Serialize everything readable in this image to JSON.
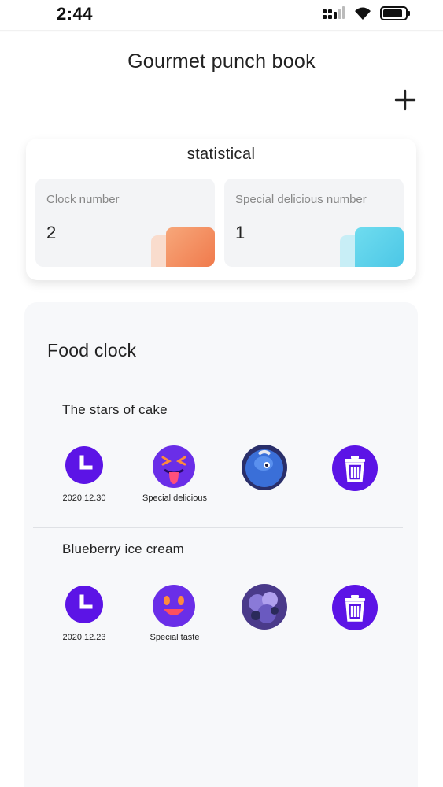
{
  "status_bar": {
    "time": "2:44"
  },
  "header": {
    "title": "Gourmet punch book"
  },
  "statistics": {
    "title": "statistical",
    "clock": {
      "label": "Clock number",
      "value": "2",
      "accent": "#f28a5a"
    },
    "special": {
      "label": "Special delicious number",
      "value": "1",
      "accent": "#56cfe6"
    }
  },
  "food_clock": {
    "title": "Food clock",
    "entries": [
      {
        "name": "The stars of cake",
        "date": "2020.12.30",
        "rating": "Special delicious"
      },
      {
        "name": "Blueberry ice cream",
        "date": "2020.12.23",
        "rating": "Special taste"
      }
    ]
  },
  "colors": {
    "icon_purple": "#5c14e6",
    "emoji_purple": "#6a2ee8"
  }
}
